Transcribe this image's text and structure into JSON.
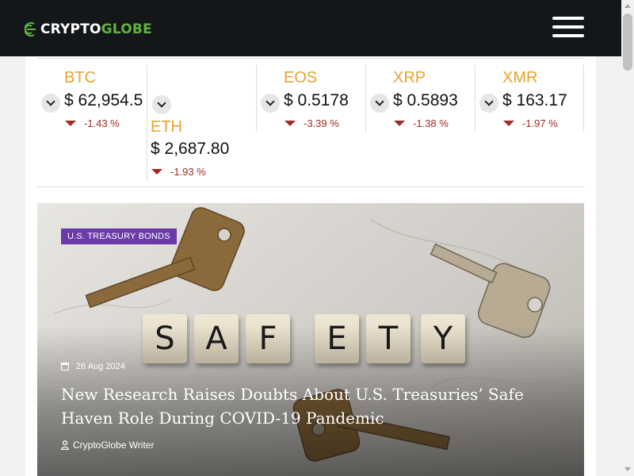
{
  "header": {
    "logo_part1": "CRYPTO",
    "logo_part2": "GLOBE",
    "menu_icon": "hamburger-menu-icon"
  },
  "ticker": [
    {
      "symbol": "BTC",
      "price": "$ 62,954.5",
      "change": "-1.43 %",
      "direction": "down"
    },
    {
      "symbol": "ETH",
      "price": "$ 2,687.80",
      "change": "-1.93 %",
      "direction": "down"
    },
    {
      "symbol": "EOS",
      "price": "$ 0.5178",
      "change": "-3.39 %",
      "direction": "down"
    },
    {
      "symbol": "XRP",
      "price": "$ 0.5893",
      "change": "-1.38 %",
      "direction": "down"
    },
    {
      "symbol": "XMR",
      "price": "$ 163.17",
      "change": "-1.97 %",
      "direction": "down"
    }
  ],
  "featured": {
    "category": "U.S. TREASURY BONDS",
    "date": "26 Aug 2024",
    "title": "New Research Raises Doubts About U.S. Treasuries’ Safe Haven Role During COVID-19 Pandemic",
    "author": "CryptoGlobe Writer",
    "image_tiles": [
      "S",
      "A",
      "F",
      "E",
      "T",
      "Y"
    ]
  },
  "colors": {
    "header_bg": "#14171a",
    "brand_green": "#5fb33f",
    "coin_symbol": "#e6a32e",
    "negative": "#a02b22",
    "category_badge": "#6a3aa8"
  }
}
